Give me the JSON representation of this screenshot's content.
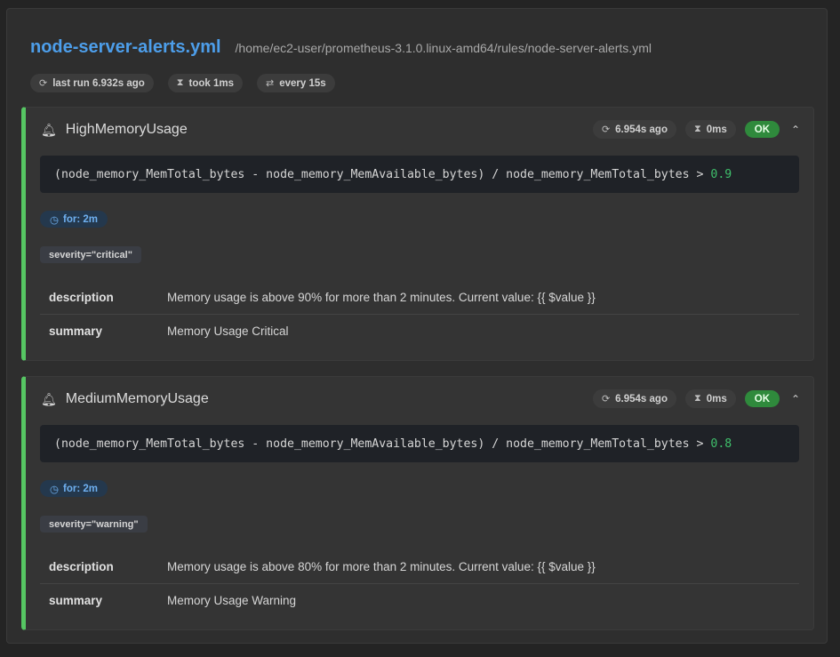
{
  "file": {
    "name": "node-server-alerts.yml",
    "path": "/home/ec2-user/prometheus-3.1.0.linux-amd64/rules/node-server-alerts.yml",
    "last_run": "last run 6.932s ago",
    "took": "took 1ms",
    "every": "every 15s"
  },
  "rules": [
    {
      "name": "HighMemoryUsage",
      "last_eval": "6.954s ago",
      "duration": "0ms",
      "state": "OK",
      "expr_prefix": "(node_memory_MemTotal_bytes - node_memory_MemAvailable_bytes) / node_memory_MemTotal_bytes > ",
      "expr_threshold": "0.9",
      "for": "for: 2m",
      "label": "severity=\"critical\"",
      "annotations": [
        {
          "key": "description",
          "value": "Memory usage is above 90% for more than 2 minutes. Current value: {{ $value }}"
        },
        {
          "key": "summary",
          "value": "Memory Usage Critical"
        }
      ]
    },
    {
      "name": "MediumMemoryUsage",
      "last_eval": "6.954s ago",
      "duration": "0ms",
      "state": "OK",
      "expr_prefix": "(node_memory_MemTotal_bytes - node_memory_MemAvailable_bytes) / node_memory_MemTotal_bytes > ",
      "expr_threshold": "0.8",
      "for": "for: 2m",
      "label": "severity=\"warning\"",
      "annotations": [
        {
          "key": "description",
          "value": "Memory usage is above 80% for more than 2 minutes. Current value: {{ $value }}"
        },
        {
          "key": "summary",
          "value": "Memory Usage Warning"
        }
      ]
    }
  ],
  "icons": {
    "refresh": "refresh-icon",
    "hourglass": "hourglass-icon",
    "repeat": "repeat-icon",
    "bell": "bell-icon",
    "clock": "clock-icon",
    "chevron": "chevron-up-icon"
  },
  "colors": {
    "accent": "#4d9eea",
    "ok": "#2f8a3c",
    "rule_border": "#56c663",
    "threshold": "#3fbf6b"
  }
}
